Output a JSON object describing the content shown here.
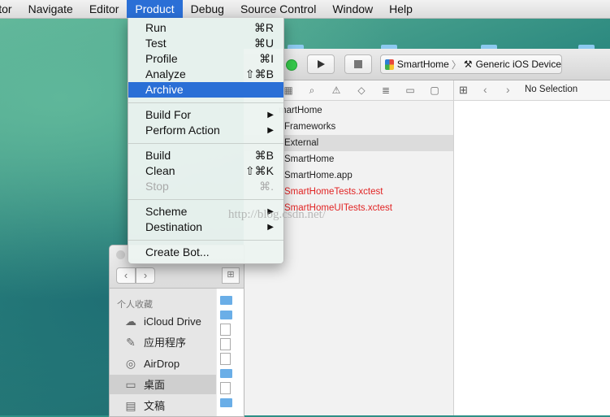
{
  "menubar": {
    "items": [
      "Editor",
      "Navigate",
      "Editor",
      "Product",
      "Debug",
      "Source Control",
      "Window",
      "Help"
    ]
  },
  "product_menu": {
    "run": {
      "label": "Run",
      "shortcut": "⌘R"
    },
    "test": {
      "label": "Test",
      "shortcut": "⌘U"
    },
    "profile": {
      "label": "Profile",
      "shortcut": "⌘I"
    },
    "analyze": {
      "label": "Analyze",
      "shortcut": "⇧⌘B"
    },
    "archive": {
      "label": "Archive"
    },
    "build_for": {
      "label": "Build For"
    },
    "perform_action": {
      "label": "Perform Action"
    },
    "build": {
      "label": "Build",
      "shortcut": "⌘B"
    },
    "clean": {
      "label": "Clean",
      "shortcut": "⇧⌘K"
    },
    "stop": {
      "label": "Stop",
      "shortcut": "⌘."
    },
    "scheme": {
      "label": "Scheme"
    },
    "destination": {
      "label": "Destination"
    },
    "create_bot": {
      "label": "Create Bot..."
    }
  },
  "xcode": {
    "scheme": {
      "app": "SmartHome",
      "device": "Generic iOS Device"
    },
    "jumpbar": {
      "text": "No Selection"
    },
    "navigator_rows": [
      {
        "label": "martHome",
        "color": "normal"
      },
      {
        "label": "Frameworks",
        "color": "normal"
      },
      {
        "label": "External",
        "color": "normal",
        "selected": true
      },
      {
        "label": "SmartHome",
        "color": "normal"
      },
      {
        "label": "SmartHome.app",
        "color": "normal"
      },
      {
        "label": "SmartHomeTests.xctest",
        "color": "red"
      },
      {
        "label": "SmartHomeUITests.xctest",
        "color": "red"
      }
    ]
  },
  "finder": {
    "section_header": "个人收藏",
    "items": [
      {
        "label": "iCloud Drive",
        "icon": "cloud-icon"
      },
      {
        "label": "应用程序",
        "icon": "applications-icon"
      },
      {
        "label": "AirDrop",
        "icon": "airdrop-icon"
      },
      {
        "label": "桌面",
        "icon": "desktop-icon",
        "selected": true
      },
      {
        "label": "文稿",
        "icon": "documents-icon"
      }
    ]
  },
  "watermark": "http://blog.csdn.net/",
  "colors": {
    "menu_highlight": "#2a6fd6",
    "error_red": "#e12323"
  }
}
